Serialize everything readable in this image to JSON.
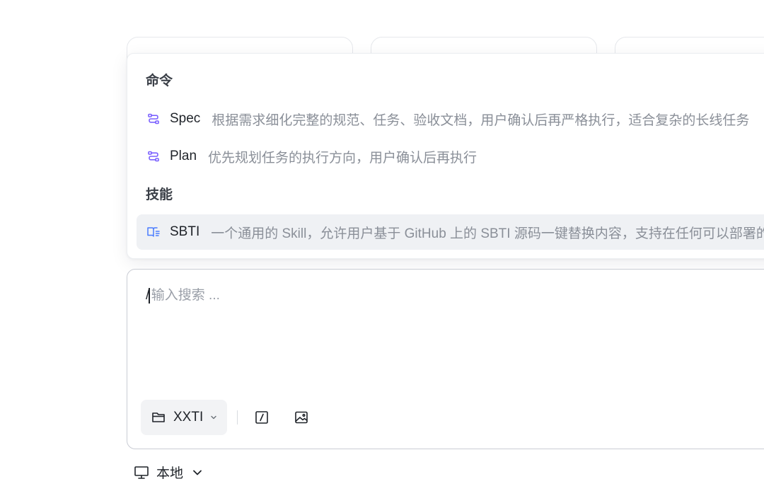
{
  "popover": {
    "commands_title": "命令",
    "commands": [
      {
        "name": "Spec",
        "description": "根据需求细化完整的规范、任务、验收文档，用户确认后再严格执行，适合复杂的长线任务",
        "icon": "workflow-icon"
      },
      {
        "name": "Plan",
        "description": "优先规划任务的执行方向，用户确认后再执行",
        "icon": "workflow-icon"
      }
    ],
    "skills_title": "技能",
    "skills": [
      {
        "name": "SBTI",
        "description": "一个通用的 Skill，允许用户基于 GitHub 上的 SBTI 源码一键替换内容，支持在任何可以部署的平台上使用",
        "icon": "book-icon",
        "selected": true
      }
    ]
  },
  "input": {
    "value": "/",
    "placeholder": "输入搜索 ..."
  },
  "toolbar": {
    "folder_label": "XXTI",
    "folder_icon": "folder-icon",
    "slash_icon": "slash-command-icon",
    "image_icon": "image-icon"
  },
  "environment": {
    "label": "本地",
    "icon": "monitor-icon"
  },
  "colors": {
    "accent": "#7b61ff",
    "selected_bg": "#eff1f4",
    "border": "#c9ccd4"
  }
}
